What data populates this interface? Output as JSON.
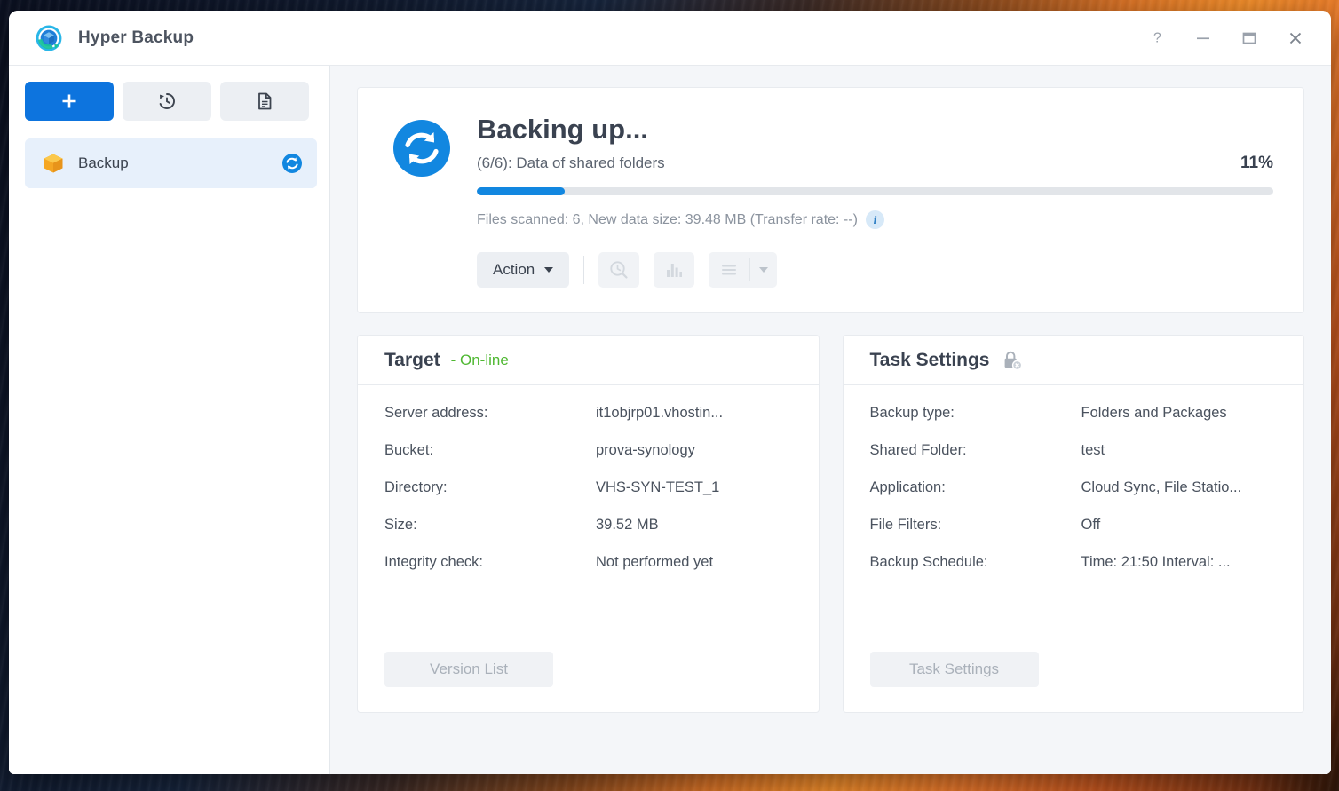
{
  "window": {
    "title": "Hyper Backup",
    "app_icon": "hyper-backup-icon",
    "controls": [
      {
        "name": "help-button",
        "glyph": "?"
      },
      {
        "name": "minimize-button",
        "glyph": "minimize-icon"
      },
      {
        "name": "maximize-button",
        "glyph": "maximize-icon"
      },
      {
        "name": "close-button",
        "glyph": "close-icon"
      }
    ]
  },
  "sidebar": {
    "toolbar": [
      {
        "name": "create-task-button",
        "icon": "plus-icon",
        "primary": true
      },
      {
        "name": "restore-button",
        "icon": "restore-clock-icon",
        "primary": false
      },
      {
        "name": "log-button",
        "icon": "document-icon",
        "primary": false
      }
    ],
    "items": [
      {
        "label": "Backup",
        "icon": "backup-box-icon",
        "badge": "sync-icon",
        "selected": true
      }
    ]
  },
  "status": {
    "icon": "sync-circle-icon",
    "title": "Backing up...",
    "subtitle": "(6/6): Data of shared folders",
    "percent_label": "11%",
    "percent_value": 11,
    "detail": "Files scanned: 6, New data size: 39.48 MB (Transfer rate: --)",
    "info_badge": "i",
    "accent_color": "#1287e0"
  },
  "toolbar": {
    "action_label": "Action",
    "buttons": [
      {
        "name": "version-explorer-button",
        "icon": "clock-search-icon",
        "disabled": true
      },
      {
        "name": "statistics-button",
        "icon": "bar-chart-icon",
        "disabled": true
      },
      {
        "name": "list-menu-button",
        "icon": "hamburger-icon",
        "disabled": true
      }
    ]
  },
  "target_panel": {
    "title": "Target",
    "status": "- On-line",
    "status_color": "#4fb832",
    "rows": [
      {
        "key": "Server address:",
        "value": "it1objrp01.vhostin..."
      },
      {
        "key": "Bucket:",
        "value": "prova-synology"
      },
      {
        "key": "Directory:",
        "value": "VHS-SYN-TEST_1"
      },
      {
        "key": "Size:",
        "value": "39.52 MB"
      },
      {
        "key": "Integrity check:",
        "value": "Not performed yet"
      }
    ],
    "button_label": "Version List"
  },
  "task_panel": {
    "title": "Task Settings",
    "icon": "lock-disabled-icon",
    "rows": [
      {
        "key": "Backup type:",
        "value": "Folders and Packages"
      },
      {
        "key": "Shared Folder:",
        "value": "test"
      },
      {
        "key": "Application:",
        "value": "Cloud Sync, File Statio..."
      },
      {
        "key": "File Filters:",
        "value": "Off"
      },
      {
        "key": "Backup Schedule:",
        "value": "Time: 21:50 Interval: ..."
      }
    ],
    "button_label": "Task Settings"
  }
}
